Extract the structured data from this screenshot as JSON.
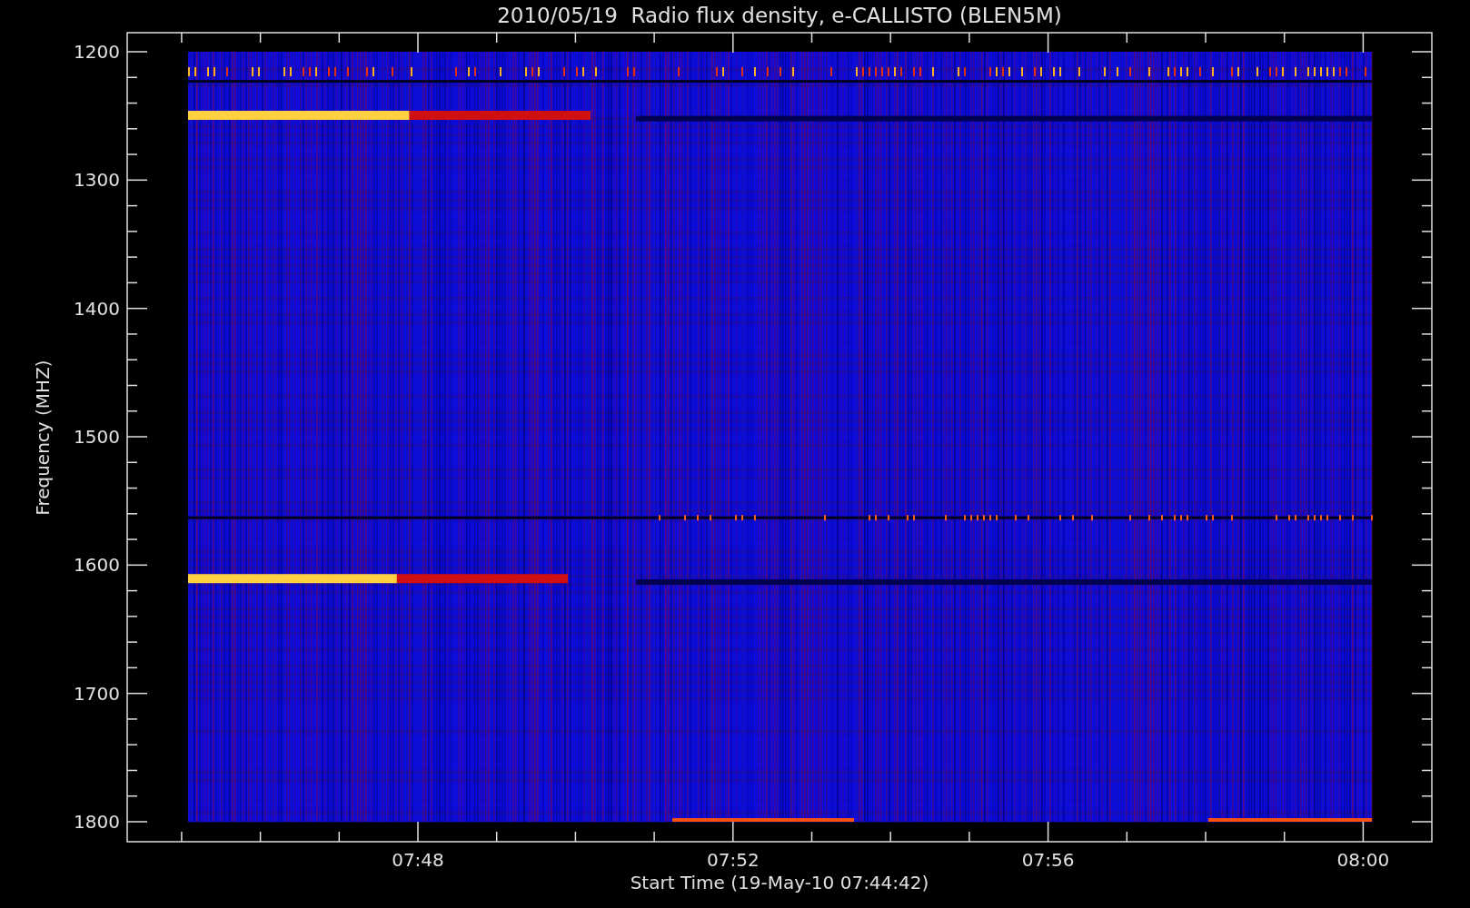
{
  "plot": {
    "title": "2010/05/19  Radio flux density, e-CALLISTO (BLEN5M)",
    "y_axis": {
      "label": "Frequency (MHZ)",
      "ticks": [
        "1200",
        "1300",
        "1400",
        "1500",
        "1600",
        "1700",
        "1800"
      ]
    },
    "x_axis": {
      "label": "Start Time (19-May-10 07:44:42)",
      "ticks": [
        "07:48",
        "07:52",
        "07:56",
        "08:00"
      ]
    }
  }
}
